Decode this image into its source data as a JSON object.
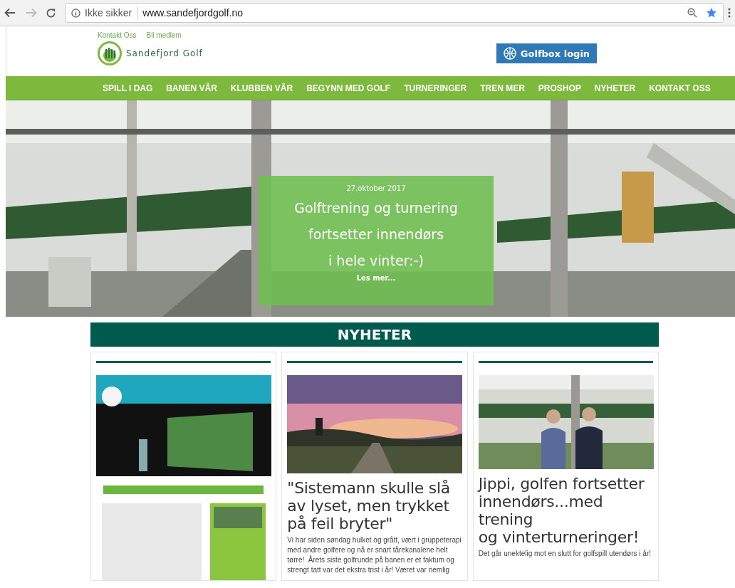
{
  "browser": {
    "security_label": "Ikke sikker",
    "url": "www.sandefjordgolf.no",
    "bookmarked": true
  },
  "top_links": [
    "Kontakt Oss",
    "Bli medlem"
  ],
  "logo_text": "Sandefjord Golf",
  "login_button": "Golfbox login",
  "nav": [
    {
      "label": "SPILL I DAG"
    },
    {
      "label": "BANEN VÅR"
    },
    {
      "label": "KLUBBEN VÅR"
    },
    {
      "label": "BEGYNN MED GOLF"
    },
    {
      "label": "TURNERINGER"
    },
    {
      "label": "TREN MER"
    },
    {
      "label": "PROSHOP"
    },
    {
      "label": "NYHETER"
    },
    {
      "label": "KONTAKT OSS"
    }
  ],
  "hero": {
    "kind": "picture",
    "date": "27.oktober 2017",
    "headline": "Golftrening og turnering\nfortsetter innendørs\ni hele vinter:-)",
    "link": "Les mer..."
  },
  "news": {
    "heading": "NYHETER",
    "cards": [
      {
        "kind": "picture"
      },
      {
        "kind": "picture",
        "title": "\"Sistemann skulle slå av lyset, men trykket på feil bryter\"",
        "excerpt": "Vi har siden søndag hulket og grått, vært i gruppeterapi med andre golfere og nå er snart tårekanalene helt tørre!  Årets siste golfrunde på banen er et faktum og strengt tatt var det ekstra trist i år! Været var nemlig"
      },
      {
        "kind": "picture",
        "title": "Jippi, golfen fortsetter innendørs...med trening\nog vinterturneringer!",
        "excerpt": "Det går unektelig mot en slutt for golfspill utendørs i år!"
      }
    ]
  }
}
